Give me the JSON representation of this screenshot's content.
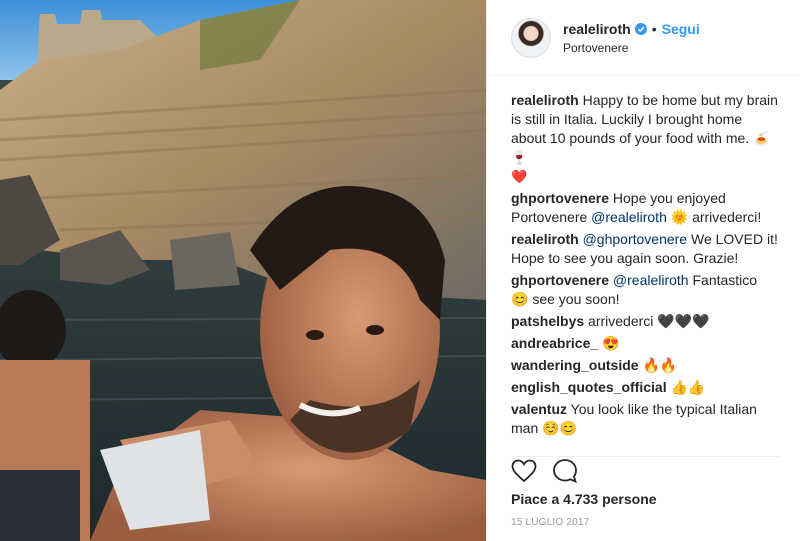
{
  "post": {
    "username": "realeliroth",
    "follow_label": "Segui",
    "dot": "•",
    "location": "Portovenere",
    "caption": {
      "username": "realeliroth",
      "text": "Happy to be home but my brain is still in Italia. Luckily I brought home about 10 pounds of your food with me.",
      "emoji": "🍝🍷",
      "emoji2": "❤️"
    },
    "comments": [
      {
        "username": "ghportovenere",
        "pre": "Hope you enjoyed Portovenere ",
        "mention": "@realeliroth",
        "post": " 🌞 arrivederci!"
      },
      {
        "username": "realeliroth",
        "pre": "",
        "mention": "@ghportovenere",
        "post": " We LOVED it! Hope to see you again soon. Grazie!"
      },
      {
        "username": "ghportovenere",
        "pre": "",
        "mention": "@realeliroth",
        "post": " Fantastico 😊 see you soon!"
      },
      {
        "username": "patshelbys",
        "pre": "arrivederci 🖤🖤🖤",
        "mention": "",
        "post": ""
      },
      {
        "username": "andreabrice_",
        "pre": "😍",
        "mention": "",
        "post": ""
      },
      {
        "username": "wandering_outside",
        "pre": "🔥🔥",
        "mention": "",
        "post": ""
      },
      {
        "username": "english_quotes_official",
        "pre": "👍👍",
        "mention": "",
        "post": ""
      },
      {
        "username": "valentuz",
        "pre": "You look like the typical Italian man ☺️😊",
        "mention": "",
        "post": ""
      }
    ],
    "likes_text": "Piace a 4.733 persone",
    "date": "15 LUGLIO 2017"
  },
  "icons": {
    "verified": "verified-badge-icon",
    "like": "heart-outline-icon",
    "comment": "comment-bubble-icon"
  },
  "colors": {
    "accent": "#3897f0",
    "mention": "#003569",
    "muted": "#999999"
  }
}
